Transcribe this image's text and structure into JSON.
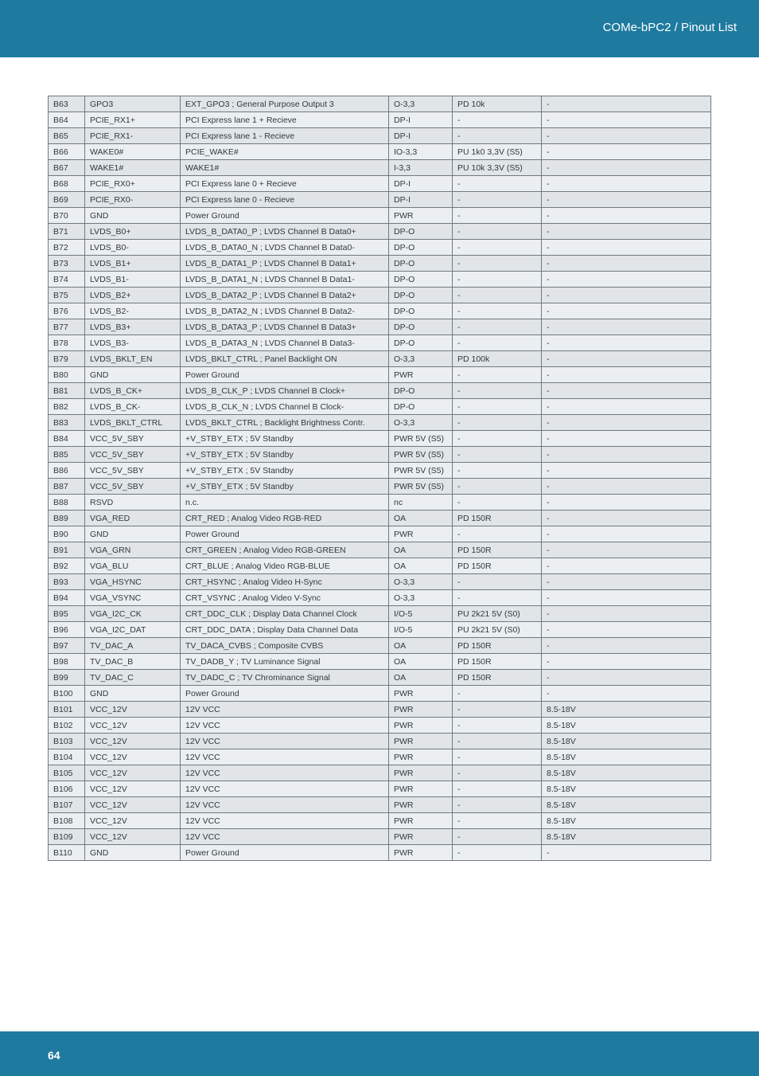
{
  "header": {
    "breadcrumb": "COMe-bPC2 / Pinout List"
  },
  "footer": {
    "page_number": "64"
  },
  "rows": [
    {
      "id": "B63",
      "signal": "GPO3",
      "desc": "EXT_GPO3 ; General Purpose Output 3",
      "type": "O-3,3",
      "pupd": "PD 10k",
      "note": "-"
    },
    {
      "id": "B64",
      "signal": "PCIE_RX1+",
      "desc": "PCI Express lane 1 + Recieve",
      "type": "DP-I",
      "pupd": "-",
      "note": "-"
    },
    {
      "id": "B65",
      "signal": "PCIE_RX1-",
      "desc": "PCI Express lane 1 - Recieve",
      "type": "DP-I",
      "pupd": "-",
      "note": "-"
    },
    {
      "id": "B66",
      "signal": "WAKE0#",
      "desc": "PCIE_WAKE#",
      "type": "IO-3,3",
      "pupd": "PU 1k0 3,3V (S5)",
      "note": "-"
    },
    {
      "id": "B67",
      "signal": "WAKE1#",
      "desc": "WAKE1#",
      "type": "I-3,3",
      "pupd": "PU 10k 3,3V (S5)",
      "note": "-"
    },
    {
      "id": "B68",
      "signal": "PCIE_RX0+",
      "desc": "PCI Express lane 0 + Recieve",
      "type": "DP-I",
      "pupd": "-",
      "note": "-"
    },
    {
      "id": "B69",
      "signal": "PCIE_RX0-",
      "desc": "PCI Express lane 0 - Recieve",
      "type": "DP-I",
      "pupd": "-",
      "note": "-"
    },
    {
      "id": "B70",
      "signal": "GND",
      "desc": "Power Ground",
      "type": "PWR",
      "pupd": "-",
      "note": "-"
    },
    {
      "id": "B71",
      "signal": "LVDS_B0+",
      "desc": "LVDS_B_DATA0_P ; LVDS Channel B Data0+",
      "type": "DP-O",
      "pupd": "-",
      "note": "-"
    },
    {
      "id": "B72",
      "signal": "LVDS_B0-",
      "desc": "LVDS_B_DATA0_N ; LVDS Channel B Data0-",
      "type": "DP-O",
      "pupd": "-",
      "note": "-"
    },
    {
      "id": "B73",
      "signal": "LVDS_B1+",
      "desc": "LVDS_B_DATA1_P ; LVDS Channel B Data1+",
      "type": "DP-O",
      "pupd": "-",
      "note": "-"
    },
    {
      "id": "B74",
      "signal": "LVDS_B1-",
      "desc": "LVDS_B_DATA1_N ; LVDS Channel B Data1-",
      "type": "DP-O",
      "pupd": "-",
      "note": "-"
    },
    {
      "id": "B75",
      "signal": "LVDS_B2+",
      "desc": "LVDS_B_DATA2_P ; LVDS Channel B Data2+",
      "type": "DP-O",
      "pupd": "-",
      "note": "-"
    },
    {
      "id": "B76",
      "signal": "LVDS_B2-",
      "desc": "LVDS_B_DATA2_N ; LVDS Channel B Data2-",
      "type": "DP-O",
      "pupd": "-",
      "note": "-"
    },
    {
      "id": "B77",
      "signal": "LVDS_B3+",
      "desc": "LVDS_B_DATA3_P ; LVDS Channel B Data3+",
      "type": "DP-O",
      "pupd": "-",
      "note": "-"
    },
    {
      "id": "B78",
      "signal": "LVDS_B3-",
      "desc": "LVDS_B_DATA3_N ; LVDS Channel B Data3-",
      "type": "DP-O",
      "pupd": "-",
      "note": "-"
    },
    {
      "id": "B79",
      "signal": "LVDS_BKLT_EN",
      "desc": "LVDS_BKLT_CTRL ; Panel Backlight ON",
      "type": "O-3,3",
      "pupd": "PD 100k",
      "note": "-"
    },
    {
      "id": "B80",
      "signal": "GND",
      "desc": "Power Ground",
      "type": "PWR",
      "pupd": "-",
      "note": "-"
    },
    {
      "id": "B81",
      "signal": "LVDS_B_CK+",
      "desc": "LVDS_B_CLK_P ; LVDS Channel B Clock+",
      "type": "DP-O",
      "pupd": "-",
      "note": "-"
    },
    {
      "id": "B82",
      "signal": "LVDS_B_CK-",
      "desc": "LVDS_B_CLK_N ; LVDS Channel B Clock-",
      "type": "DP-O",
      "pupd": "-",
      "note": "-"
    },
    {
      "id": "B83",
      "signal": "LVDS_BKLT_CTRL",
      "desc": "LVDS_BKLT_CTRL ; Backlight Brightness Contr.",
      "type": "O-3,3",
      "pupd": "-",
      "note": "-"
    },
    {
      "id": "B84",
      "signal": "VCC_5V_SBY",
      "desc": "+V_STBY_ETX ; 5V Standby",
      "type": "PWR 5V (S5)",
      "pupd": "-",
      "note": "-"
    },
    {
      "id": "B85",
      "signal": "VCC_5V_SBY",
      "desc": "+V_STBY_ETX ; 5V Standby",
      "type": "PWR 5V (S5)",
      "pupd": "-",
      "note": "-"
    },
    {
      "id": "B86",
      "signal": "VCC_5V_SBY",
      "desc": "+V_STBY_ETX ; 5V Standby",
      "type": "PWR 5V (S5)",
      "pupd": "-",
      "note": "-"
    },
    {
      "id": "B87",
      "signal": "VCC_5V_SBY",
      "desc": "+V_STBY_ETX ; 5V Standby",
      "type": "PWR 5V (S5)",
      "pupd": "-",
      "note": "-"
    },
    {
      "id": "B88",
      "signal": "RSVD",
      "desc": "n.c.",
      "type": "nc",
      "pupd": "-",
      "note": "-"
    },
    {
      "id": "B89",
      "signal": "VGA_RED",
      "desc": "CRT_RED ; Analog Video RGB-RED",
      "type": "OA",
      "pupd": "PD 150R",
      "note": "-"
    },
    {
      "id": "B90",
      "signal": "GND",
      "desc": "Power Ground",
      "type": "PWR",
      "pupd": "-",
      "note": "-"
    },
    {
      "id": "B91",
      "signal": "VGA_GRN",
      "desc": "CRT_GREEN ; Analog Video RGB-GREEN",
      "type": "OA",
      "pupd": "PD 150R",
      "note": "-"
    },
    {
      "id": "B92",
      "signal": "VGA_BLU",
      "desc": "CRT_BLUE ; Analog Video RGB-BLUE",
      "type": "OA",
      "pupd": "PD 150R",
      "note": "-"
    },
    {
      "id": "B93",
      "signal": "VGA_HSYNC",
      "desc": "CRT_HSYNC ; Analog Video H-Sync",
      "type": "O-3,3",
      "pupd": "-",
      "note": "-"
    },
    {
      "id": "B94",
      "signal": "VGA_VSYNC",
      "desc": "CRT_VSYNC ; Analog Video V-Sync",
      "type": "O-3,3",
      "pupd": "-",
      "note": "-"
    },
    {
      "id": "B95",
      "signal": "VGA_I2C_CK",
      "desc": "CRT_DDC_CLK ; Display Data Channel Clock",
      "type": "I/O-5",
      "pupd": "PU 2k21 5V (S0)",
      "note": "-"
    },
    {
      "id": "B96",
      "signal": "VGA_I2C_DAT",
      "desc": "CRT_DDC_DATA ; Display Data Channel Data",
      "type": "I/O-5",
      "pupd": "PU 2k21 5V (S0)",
      "note": "-"
    },
    {
      "id": "B97",
      "signal": "TV_DAC_A",
      "desc": "TV_DACA_CVBS ; Composite CVBS",
      "type": "OA",
      "pupd": "PD 150R",
      "note": "-"
    },
    {
      "id": "B98",
      "signal": "TV_DAC_B",
      "desc": "TV_DADB_Y ; TV Luminance Signal",
      "type": "OA",
      "pupd": "PD 150R",
      "note": "-"
    },
    {
      "id": "B99",
      "signal": "TV_DAC_C",
      "desc": "TV_DADC_C ; TV Chrominance Signal",
      "type": "OA",
      "pupd": "PD 150R",
      "note": "-"
    },
    {
      "id": "B100",
      "signal": "GND",
      "desc": "Power Ground",
      "type": "PWR",
      "pupd": "-",
      "note": "-"
    },
    {
      "id": "B101",
      "signal": "VCC_12V",
      "desc": "12V VCC",
      "type": "PWR",
      "pupd": "-",
      "note": "8.5-18V"
    },
    {
      "id": "B102",
      "signal": "VCC_12V",
      "desc": "12V VCC",
      "type": "PWR",
      "pupd": "-",
      "note": "8.5-18V"
    },
    {
      "id": "B103",
      "signal": "VCC_12V",
      "desc": "12V VCC",
      "type": "PWR",
      "pupd": "-",
      "note": "8.5-18V"
    },
    {
      "id": "B104",
      "signal": "VCC_12V",
      "desc": "12V VCC",
      "type": "PWR",
      "pupd": "-",
      "note": "8.5-18V"
    },
    {
      "id": "B105",
      "signal": "VCC_12V",
      "desc": "12V VCC",
      "type": "PWR",
      "pupd": "-",
      "note": "8.5-18V"
    },
    {
      "id": "B106",
      "signal": "VCC_12V",
      "desc": "12V VCC",
      "type": "PWR",
      "pupd": "-",
      "note": "8.5-18V"
    },
    {
      "id": "B107",
      "signal": "VCC_12V",
      "desc": "12V VCC",
      "type": "PWR",
      "pupd": "-",
      "note": "8.5-18V"
    },
    {
      "id": "B108",
      "signal": "VCC_12V",
      "desc": "12V VCC",
      "type": "PWR",
      "pupd": "-",
      "note": "8.5-18V"
    },
    {
      "id": "B109",
      "signal": "VCC_12V",
      "desc": "12V VCC",
      "type": "PWR",
      "pupd": "-",
      "note": "8.5-18V"
    },
    {
      "id": "B110",
      "signal": "GND",
      "desc": "Power Ground",
      "type": "PWR",
      "pupd": "-",
      "note": "-"
    }
  ]
}
